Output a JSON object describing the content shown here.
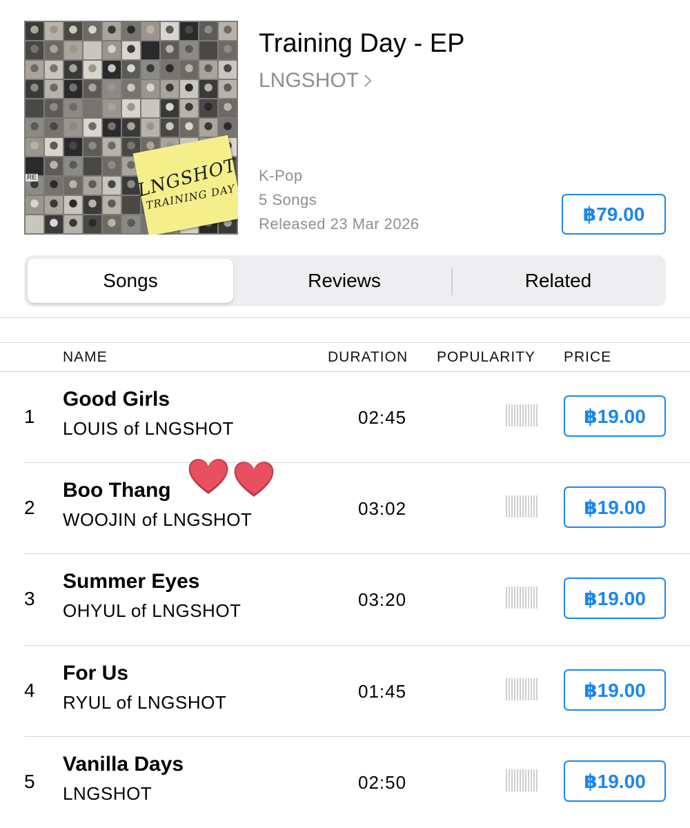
{
  "album": {
    "title": "Training Day - EP",
    "artist": "LNGSHOT",
    "genre": "K-Pop",
    "song_count": "5 Songs",
    "released": "Released 23 Mar 2026",
    "price": "฿79.00",
    "cover_text": [
      "LNGSHOT",
      "TRAINING DAY",
      "RE"
    ]
  },
  "tabs": [
    {
      "label": "Songs",
      "active": true
    },
    {
      "label": "Reviews",
      "active": false
    },
    {
      "label": "Related",
      "active": false
    }
  ],
  "table": {
    "headers": {
      "name": "NAME",
      "duration": "DURATION",
      "popularity": "POPULARITY",
      "price": "PRICE"
    },
    "rows": [
      {
        "num": "1",
        "title": "Good Girls",
        "artist": "LOUIS of LNGSHOT",
        "duration": "02:45",
        "price": "฿19.00"
      },
      {
        "num": "2",
        "title": "Boo Thang",
        "artist": "WOOJIN of LNGSHOT",
        "duration": "03:02",
        "price": "฿19.00"
      },
      {
        "num": "3",
        "title": "Summer Eyes",
        "artist": "OHYUL of LNGSHOT",
        "duration": "03:20",
        "price": "฿19.00"
      },
      {
        "num": "4",
        "title": "For Us",
        "artist": "RYUL of LNGSHOT",
        "duration": "01:45",
        "price": "฿19.00"
      },
      {
        "num": "5",
        "title": "Vanilla Days",
        "artist": "LNGSHOT",
        "duration": "02:50",
        "price": "฿19.00"
      }
    ]
  },
  "colors": {
    "accent": "#1a86f0",
    "secondary_text": "#8e8e93",
    "heart": "#e8505f"
  },
  "icons": {
    "artist_link": "chevron-right-icon",
    "sticker": "heart-icon"
  }
}
